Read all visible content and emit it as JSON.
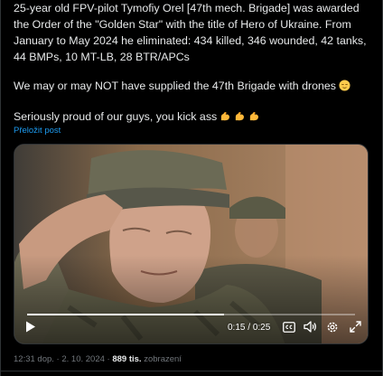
{
  "post": {
    "text_lines": [
      "25-year old FPV-pilot Tymofiy Orel [47th mech. Brigade] was awarded",
      "the Order of the \"Golden Star\" with the title of Hero of Ukraine. From",
      "January to May 2024 he eliminated: 434 killed, 346 wounded, 42 tanks,",
      "44 BMPs, 10 MT-LB, 28 BTR/APCs"
    ],
    "paragraph2": "We may or may NOT have supplied the 47th Brigade with drones",
    "paragraph3": "Seriously proud of our guys, you kick ass",
    "translate_link": "Přeložit post"
  },
  "video": {
    "time_current": "0:15",
    "time_total": "0:25",
    "time_separator": "/",
    "progress": 0.6,
    "icons": [
      "play-icon",
      "captions-icon",
      "volume-icon",
      "settings-icon",
      "fullscreen-icon"
    ]
  },
  "meta": {
    "time": "12:31 dop.",
    "separator": "·",
    "date": "2. 10. 2024",
    "views_count": "889 tis.",
    "views_label": "zobrazení"
  },
  "colors": {
    "background": "#000000",
    "text": "#e7e9ea",
    "muted": "#71767b",
    "link": "#1d9bf0",
    "border": "#2f3336"
  }
}
